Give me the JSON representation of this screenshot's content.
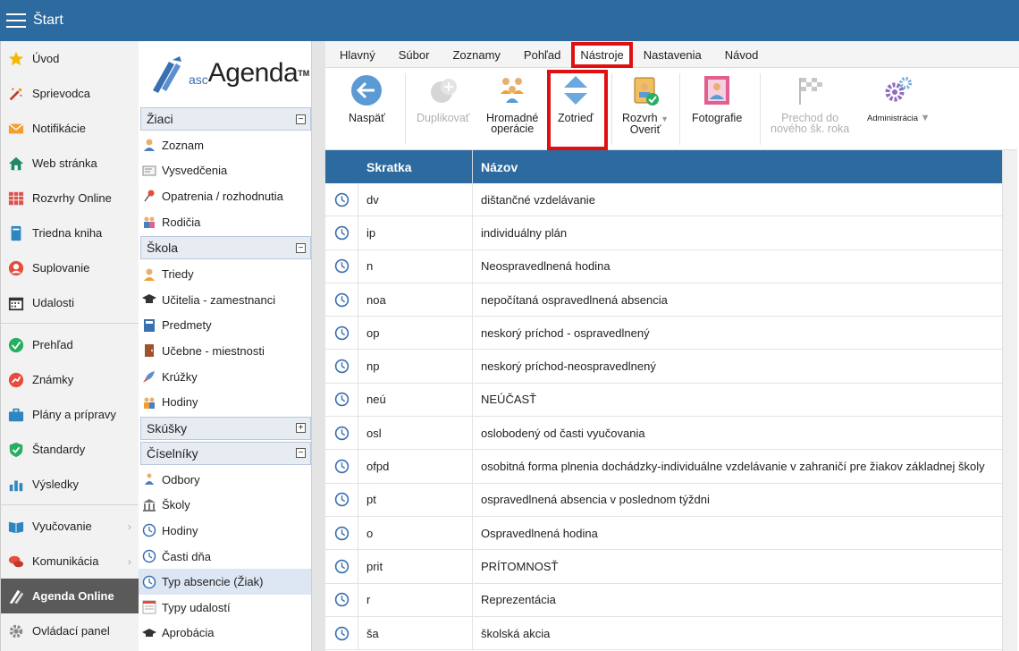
{
  "topbar": {
    "title": "Štart"
  },
  "sidebar": {
    "group1": [
      {
        "label": "Úvod",
        "icon": "star-icon"
      },
      {
        "label": "Sprievodca",
        "icon": "magic-wand-icon"
      },
      {
        "label": "Notifikácie",
        "icon": "envelope-icon"
      },
      {
        "label": "Web stránka",
        "icon": "house-icon"
      },
      {
        "label": "Rozvrhy Online",
        "icon": "timetable-icon"
      },
      {
        "label": "Triedna kniha",
        "icon": "book-icon"
      },
      {
        "label": "Suplovanie",
        "icon": "person-icon"
      },
      {
        "label": "Udalosti",
        "icon": "calendar-icon"
      }
    ],
    "group2": [
      {
        "label": "Prehľad",
        "icon": "check-circle-icon"
      },
      {
        "label": "Známky",
        "icon": "grades-icon"
      },
      {
        "label": "Plány a prípravy",
        "icon": "briefcase-icon"
      },
      {
        "label": "Štandardy",
        "icon": "shield-check-icon"
      },
      {
        "label": "Výsledky",
        "icon": "bar-chart-icon"
      }
    ],
    "group3": [
      {
        "label": "Vyučovanie",
        "icon": "open-book-icon",
        "chevron": "›"
      },
      {
        "label": "Komunikácia",
        "icon": "chat-icon",
        "chevron": "›"
      },
      {
        "label": "Agenda Online",
        "icon": "agenda-logo-icon"
      },
      {
        "label": "Ovládací panel",
        "icon": "gear-icon"
      }
    ]
  },
  "logo": {
    "asc": "asc",
    "agenda": "Agenda",
    "tm": "TM"
  },
  "sections": {
    "ziaci": {
      "title": "Žiaci",
      "toggle": "−",
      "items": [
        {
          "label": "Zoznam",
          "icon": "user-icon"
        },
        {
          "label": "Vysvedčenia",
          "icon": "certificate-icon"
        },
        {
          "label": "Opatrenia / rozhodnutia",
          "icon": "pin-icon"
        },
        {
          "label": "Rodičia",
          "icon": "parents-icon"
        }
      ]
    },
    "skola": {
      "title": "Škola",
      "toggle": "−",
      "items": [
        {
          "label": "Triedy",
          "icon": "class-icon"
        },
        {
          "label": "Učitelia - zamestnanci",
          "icon": "graduation-cap-icon"
        },
        {
          "label": "Predmety",
          "icon": "subject-icon"
        },
        {
          "label": "Učebne - miestnosti",
          "icon": "door-icon"
        },
        {
          "label": "Krúžky",
          "icon": "rocket-icon"
        },
        {
          "label": "Hodiny",
          "icon": "group-icon"
        }
      ]
    },
    "skusky": {
      "title": "Skúšky",
      "toggle": "+"
    },
    "ciselniky": {
      "title": "Číselníky",
      "toggle": "−",
      "items": [
        {
          "label": "Odbory",
          "icon": "people-icon"
        },
        {
          "label": "Školy",
          "icon": "building-icon"
        },
        {
          "label": "Hodiny",
          "icon": "clock-icon"
        },
        {
          "label": "Časti dňa",
          "icon": "clock-icon"
        },
        {
          "label": "Typ absencie (Žiak)",
          "icon": "clock-icon"
        },
        {
          "label": "Typy udalostí",
          "icon": "list-icon"
        },
        {
          "label": "Aprobácia",
          "icon": "cap-icon"
        }
      ]
    }
  },
  "tabs": [
    "Hlavný",
    "Súbor",
    "Zoznamy",
    "Pohľad",
    "Nástroje",
    "Nastavenia",
    "Návod"
  ],
  "toolbar": {
    "back": "Naspäť",
    "duplicate": "Duplikovať",
    "bulk1": "Hromadné",
    "bulk2": "operácie",
    "sort": "Zotrieď",
    "verify1": "Rozvrh",
    "verify2": "Overiť",
    "photos": "Fotografie",
    "newyear1": "Prechod do",
    "newyear2": "nového šk. roka",
    "admin": "Administrácia",
    "dropdown": "▼"
  },
  "table": {
    "headers": {
      "code": "Skratka",
      "name": "Názov"
    },
    "rows": [
      {
        "code": "dv",
        "name": "dištančné vzdelávanie"
      },
      {
        "code": "ip",
        "name": "individuálny plán"
      },
      {
        "code": "n",
        "name": "Neospravedlnená hodina"
      },
      {
        "code": "noa",
        "name": "nepočítaná ospravedlnená absencia"
      },
      {
        "code": "op",
        "name": "neskorý príchod - ospravedlnený"
      },
      {
        "code": "np",
        "name": "neskorý príchod-neospravedlnený"
      },
      {
        "code": "neú",
        "name": "NEÚČASŤ"
      },
      {
        "code": "osl",
        "name": "oslobodený od časti vyučovania"
      },
      {
        "code": "ofpd",
        "name": "osobitná forma plnenia dochádzky-individuálne vzdelávanie v zahraničí pre žiakov základnej školy"
      },
      {
        "code": "pt",
        "name": "ospravedlnená absencia v poslednom týždni"
      },
      {
        "code": "o",
        "name": "Ospravedlnená hodina"
      },
      {
        "code": "prit",
        "name": "PRÍTOMNOSŤ"
      },
      {
        "code": "r",
        "name": "Reprezentácia"
      },
      {
        "code": "ša",
        "name": "školská akcia"
      }
    ]
  },
  "colors": {
    "primary": "#2d6aa0",
    "highlight": "#e01010",
    "selected": "#dde6f3"
  }
}
